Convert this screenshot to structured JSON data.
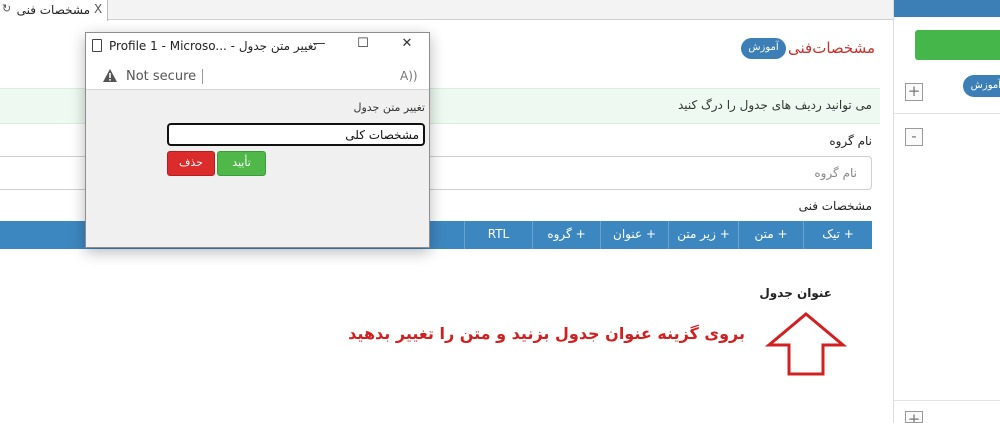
{
  "tab": {
    "title": "مشخصات فنی",
    "close_glyph": "X"
  },
  "sidebar": {
    "badge": "آموزش",
    "plus_glyph": "+",
    "minus_glyph": "-"
  },
  "page": {
    "title": "مشخصات‌فنی",
    "badge": "آموزش",
    "info": "می توانید ردیف های جدول را درگ کنید",
    "group_label": "نام گروه",
    "group_placeholder": "نام گروه",
    "spec_label": "مشخصات فنی",
    "table_title": "عنوان جدول",
    "annotation": "بروی گزینه عنوان جدول بزنید و متن را تغییر بدهید"
  },
  "toolbar": {
    "items": [
      "+ تیک",
      "+ متن",
      "+ زیر متن",
      "+ عنوان",
      "+ گروه",
      "RTL"
    ]
  },
  "popup": {
    "window_title": "Profile 1 - Microso... - تغییر متن جدول",
    "minimize": "—",
    "maximize": "☐",
    "close": "✕",
    "not_secure": "Not secure",
    "read_aloud": "A))",
    "label": "تغییر متن جدول",
    "input_value": "مشخصات کلی",
    "delete_label": "حذف",
    "confirm_label": "تأیید"
  },
  "colors": {
    "accent_blue": "#3d87c0",
    "title_red": "#c9302c",
    "annotation_red": "#d21f1f",
    "green": "#45b64a",
    "info_bg": "#eefaf1"
  }
}
